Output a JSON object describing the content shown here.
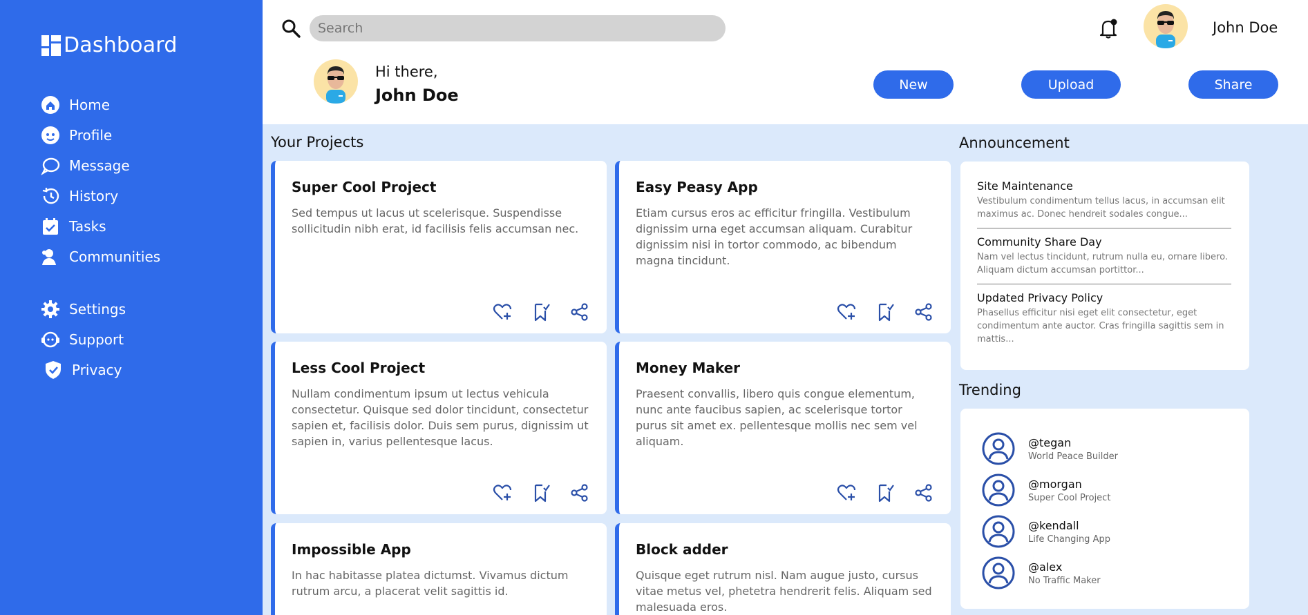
{
  "brand": {
    "title": "Dashboard"
  },
  "nav": {
    "primary": [
      {
        "label": "Home",
        "icon": "home-icon"
      },
      {
        "label": "Profile",
        "icon": "profile-icon"
      },
      {
        "label": "Message",
        "icon": "message-icon"
      },
      {
        "label": "History",
        "icon": "history-icon"
      },
      {
        "label": "Tasks",
        "icon": "tasks-icon"
      },
      {
        "label": "Communities",
        "icon": "communities-icon"
      }
    ],
    "secondary": [
      {
        "label": "Settings",
        "icon": "gear-icon"
      },
      {
        "label": "Support",
        "icon": "support-icon"
      },
      {
        "label": "Privacy",
        "icon": "shield-icon"
      }
    ]
  },
  "header": {
    "search_placeholder": "Search",
    "user_name": "John Doe",
    "greeting": "Hi there,",
    "greeting_name": "John Doe",
    "buttons": {
      "new": "New",
      "upload": "Upload",
      "share": "Share"
    }
  },
  "projects": {
    "title": "Your Projects",
    "items": [
      {
        "title": "Super Cool Project",
        "desc": "Sed tempus ut lacus ut scelerisque. Suspendisse sollicitudin nibh erat, id facilisis felis accumsan nec."
      },
      {
        "title": "Easy Peasy App",
        "desc": "Etiam cursus eros ac efficitur fringilla. Vestibulum dignissim urna eget accumsan aliquam. Curabitur dignissim nisi in tortor commodo, ac bibendum magna tincidunt."
      },
      {
        "title": "Less Cool Project",
        "desc": "Nullam condimentum ipsum ut lectus vehicula consectetur. Quisque sed dolor tincidunt, consectetur sapien et, facilisis dolor. Duis sem purus, dignissim ut sapien in, varius pellentesque lacus."
      },
      {
        "title": "Money Maker",
        "desc": "Praesent convallis, libero quis congue elementum, nunc ante faucibus sapien, ac scelerisque tortor purus sit amet ex. pellentesque mollis nec sem vel aliquam."
      },
      {
        "title": "Impossible App",
        "desc": "In hac habitasse platea dictumst. Vivamus dictum rutrum arcu, a placerat velit sagittis id."
      },
      {
        "title": "Block adder",
        "desc": "Quisque eget rutrum nisl. Nam augue justo, cursus vitae metus vel, phetetra hendrerit felis. Aliquam sed malesuada eros."
      }
    ]
  },
  "announcements": {
    "title": "Announcement",
    "items": [
      {
        "title": "Site Maintenance",
        "text": "Vestibulum condimentum tellus lacus, in accumsan elit maximus ac. Donec hendreit sodales congue..."
      },
      {
        "title": "Community Share Day",
        "text": "Nam vel lectus tincidunt, rutrum nulla eu, ornare libero. Aliquam dictum accumsan portittor..."
      },
      {
        "title": "Updated Privacy Policy",
        "text": "Phasellus efficitur nisi eget elit consectetur, eget condimentum ante auctor. Cras fringilla sagittis sem in mattis..."
      }
    ]
  },
  "trending": {
    "title": "Trending",
    "items": [
      {
        "handle": "@tegan",
        "sub": "World Peace Builder"
      },
      {
        "handle": "@morgan",
        "sub": "Super Cool Project"
      },
      {
        "handle": "@kendall",
        "sub": "Life Changing App"
      },
      {
        "handle": "@alex",
        "sub": "No Traffic Maker"
      }
    ]
  },
  "colors": {
    "accent": "#2f6bea",
    "background": "#dbe9fb",
    "avatar_bg": "#fbe3a6"
  }
}
